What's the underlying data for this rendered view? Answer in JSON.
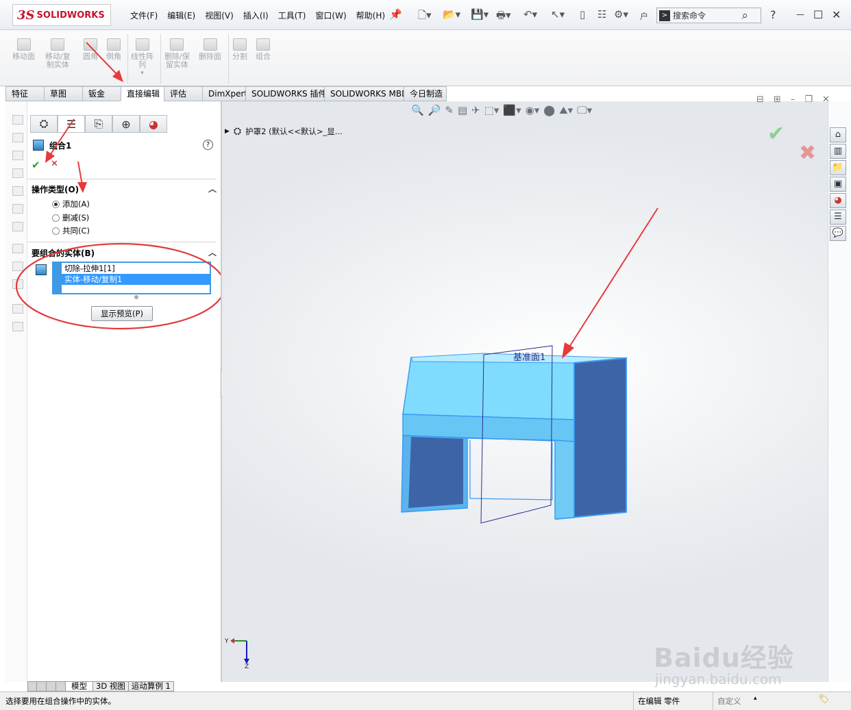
{
  "app": {
    "logo_prefix": "3S",
    "logo_text": "SOLIDWORKS"
  },
  "menus": [
    "文件(F)",
    "编辑(E)",
    "视图(V)",
    "插入(I)",
    "工具(T)",
    "窗口(W)",
    "帮助(H)"
  ],
  "quick_access": {
    "dir_label": "户"
  },
  "search": {
    "placeholder": "搜索命令"
  },
  "window_buttons": {
    "help": "?",
    "minimize": "—",
    "maximize": "☐",
    "close": "✕"
  },
  "ribbon": [
    {
      "label": "移动面"
    },
    {
      "label": "移动/复\n制实体"
    },
    {
      "label": "圆角"
    },
    {
      "label": "倒角"
    },
    {
      "label": "线性阵\n列"
    },
    {
      "label": "删除/保\n留实体"
    },
    {
      "label": "删除面"
    },
    {
      "label": "分割"
    },
    {
      "label": "组合"
    }
  ],
  "tabs": [
    "特征",
    "草图",
    "钣金",
    "直接编辑",
    "评估",
    "DimXpert",
    "SOLIDWORKS 插件",
    "SOLIDWORKS MBD",
    "今日制造"
  ],
  "active_tab": "直接编辑",
  "property_manager": {
    "title": "组合1",
    "help": "?",
    "operation_type": {
      "header": "操作类型(O)",
      "options": [
        {
          "label": "添加(A)",
          "checked": true
        },
        {
          "label": "删减(S)",
          "checked": false
        },
        {
          "label": "共同(C)",
          "checked": false
        }
      ]
    },
    "bodies": {
      "header": "要组合的实体(B)",
      "items": [
        {
          "label": "切除-拉伸1[1]",
          "selected": false
        },
        {
          "label": "实体-移动/复制1",
          "selected": true
        }
      ]
    },
    "preview_button": "显示预览(P)"
  },
  "viewport": {
    "tree_item": "护罩2  (默认<<默认>_显...",
    "plane_label": "基准面1",
    "triad": {
      "y": "Y",
      "z": "Z"
    },
    "colors": {
      "body_light": "#7fdcff",
      "body_edge": "#3b9bf0",
      "body_dark": "#3e64a8",
      "arrow": "#e83a3a"
    }
  },
  "bottom_tabs": [
    "模型",
    "3D 视图",
    "运动算例 1"
  ],
  "status": {
    "message": "选择要用在组合操作中的实体。",
    "mode": "在编辑 零件",
    "custom": "自定义"
  },
  "watermark": {
    "main": "Baidu经验",
    "sub": "jingyan.baidu.com"
  }
}
